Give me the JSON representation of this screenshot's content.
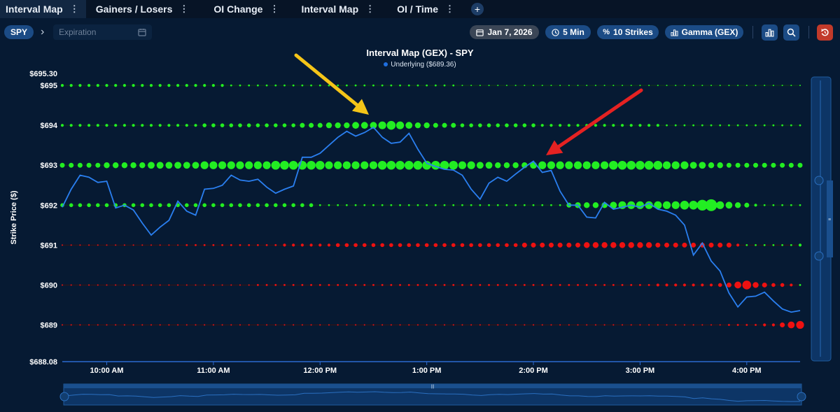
{
  "tabs": [
    {
      "label": "Interval Map",
      "active": true
    },
    {
      "label": "Gainers / Losers",
      "active": false
    },
    {
      "label": "OI Change",
      "active": false
    },
    {
      "label": "Interval Map",
      "active": false
    },
    {
      "label": "OI / Time",
      "active": false
    }
  ],
  "toolbar": {
    "symbol": "SPY",
    "expiration_placeholder": "Expiration",
    "date": "Jan 7, 2026",
    "interval": "5 Min",
    "strikes": "10 Strikes",
    "metric": "Gamma (GEX)"
  },
  "icons": {
    "tab_menu": "vertical-dots-icon",
    "add_tab": "plus-icon",
    "breadcrumb": "chevron-right-icon",
    "expiration": "calendar-icon",
    "date": "calendar-icon",
    "interval": "clock-icon",
    "strikes": "percent-icon",
    "metric": "bar-chart-icon",
    "chart_type": "bar-chart-icon",
    "search": "search-icon",
    "reset": "reset-icon"
  },
  "colors": {
    "background": "#061a33",
    "positive": "#22ee22",
    "negative": "#ee1111",
    "underlying": "#2a7ff0",
    "pill": "#1b4b85",
    "annotation_yellow": "#f5c518",
    "annotation_red": "#e52222"
  },
  "chart_data": {
    "type": "scatter",
    "title": "Interval Map (GEX) - SPY",
    "legend": [
      {
        "name": "Underlying ($689.36)",
        "color": "#2a7ff0"
      }
    ],
    "ylabel": "Strike Price ($)",
    "ylim": [
      688.08,
      695.3
    ],
    "y_top_label": "$695.30",
    "y_bottom_label": "$688.08",
    "strikes": [
      {
        "strike": 695,
        "label": "$695"
      },
      {
        "strike": 694,
        "label": "$694"
      },
      {
        "strike": 693,
        "label": "$693"
      },
      {
        "strike": 692,
        "label": "$692"
      },
      {
        "strike": 691,
        "label": "$691"
      },
      {
        "strike": 690,
        "label": "$690"
      },
      {
        "strike": 689,
        "label": "$689"
      }
    ],
    "x_ticks": [
      "10:00 AM",
      "11:00 AM",
      "12:00 PM",
      "1:00 PM",
      "2:00 PM",
      "3:00 PM",
      "4:00 PM"
    ],
    "x_tick_hours": [
      10,
      11,
      12,
      13,
      14,
      15,
      16
    ],
    "underlying_series": {
      "name": "Underlying",
      "start": "9:35 AM",
      "interval_min": 5,
      "values": [
        691.95,
        692.4,
        692.75,
        692.7,
        692.57,
        692.6,
        691.93,
        692.0,
        691.88,
        691.55,
        691.25,
        691.45,
        691.62,
        692.1,
        691.85,
        691.75,
        692.4,
        692.42,
        692.5,
        692.75,
        692.63,
        692.6,
        692.65,
        692.45,
        692.3,
        692.4,
        692.48,
        693.2,
        693.2,
        693.3,
        693.5,
        693.7,
        693.85,
        693.73,
        693.82,
        693.95,
        693.7,
        693.55,
        693.58,
        693.8,
        693.4,
        693.05,
        692.97,
        692.9,
        692.88,
        692.75,
        692.4,
        692.15,
        692.55,
        692.7,
        692.6,
        692.78,
        692.95,
        693.1,
        692.82,
        692.87,
        692.35,
        692.0,
        692.0,
        691.7,
        691.68,
        692.07,
        691.9,
        691.95,
        692.0,
        691.95,
        692.05,
        691.9,
        691.85,
        691.75,
        691.5,
        690.75,
        691.05,
        690.6,
        690.35,
        689.8,
        689.45,
        689.7,
        689.72,
        689.82,
        689.6,
        689.4,
        689.32,
        689.36
      ]
    },
    "gex_bubbles": [
      {
        "strike": 695,
        "values": [
          3,
          3,
          3,
          3,
          3,
          3,
          3,
          3,
          3,
          3,
          3,
          3,
          3,
          3,
          3,
          3,
          3,
          3,
          3,
          2,
          2,
          2,
          2,
          2,
          2,
          2,
          2,
          2,
          2,
          2,
          2,
          2,
          2,
          2,
          2,
          2,
          2,
          2,
          2,
          2,
          2,
          2,
          2,
          2,
          2,
          1,
          1,
          1,
          1,
          1,
          1,
          1,
          1,
          1,
          1,
          1,
          1,
          1,
          1,
          1,
          1,
          1,
          1,
          1,
          1,
          1,
          1,
          1,
          1,
          1,
          1,
          1,
          1,
          1,
          1,
          1,
          1,
          1,
          1,
          1,
          1,
          1,
          1,
          1
        ]
      },
      {
        "strike": 694,
        "values": [
          3,
          3,
          3,
          3,
          3,
          3,
          3,
          3,
          3,
          3,
          3,
          3,
          3,
          3,
          3,
          3,
          4,
          4,
          4,
          4,
          4,
          4,
          4,
          4,
          4,
          4,
          4,
          5,
          5,
          5,
          6,
          6,
          6,
          7,
          7,
          7,
          8,
          9,
          8,
          7,
          6,
          6,
          5,
          5,
          5,
          4,
          4,
          4,
          4,
          4,
          4,
          4,
          4,
          4,
          3,
          3,
          3,
          3,
          3,
          3,
          3,
          3,
          3,
          3,
          3,
          3,
          3,
          3,
          2,
          2,
          2,
          2,
          2,
          2,
          2,
          2,
          2,
          2,
          2,
          2,
          2,
          2,
          2,
          2
        ]
      },
      {
        "strike": 693,
        "values": [
          5,
          5,
          5,
          5,
          5,
          6,
          6,
          6,
          6,
          6,
          7,
          7,
          7,
          7,
          7,
          7,
          8,
          8,
          8,
          8,
          8,
          8,
          8,
          8,
          9,
          9,
          9,
          9,
          9,
          9,
          8,
          8,
          8,
          8,
          8,
          8,
          9,
          9,
          9,
          9,
          9,
          9,
          9,
          9,
          9,
          8,
          8,
          7,
          7,
          6,
          6,
          6,
          6,
          7,
          8,
          8,
          8,
          8,
          8,
          8,
          8,
          8,
          9,
          9,
          9,
          9,
          9,
          9,
          8,
          8,
          8,
          7,
          7,
          6,
          6,
          5,
          5,
          5,
          5,
          5,
          5,
          5,
          5,
          5
        ]
      },
      {
        "strike": 692,
        "values": [
          4,
          4,
          4,
          4,
          4,
          4,
          4,
          4,
          4,
          4,
          4,
          4,
          4,
          4,
          4,
          4,
          4,
          4,
          4,
          4,
          4,
          4,
          4,
          4,
          4,
          4,
          4,
          4,
          4,
          2,
          2,
          2,
          2,
          2,
          2,
          2,
          2,
          2,
          2,
          2,
          2,
          2,
          2,
          2,
          2,
          2,
          2,
          2,
          2,
          2,
          2,
          2,
          2,
          2,
          2,
          2,
          2,
          5,
          6,
          6,
          6,
          6,
          7,
          8,
          8,
          8,
          8,
          8,
          8,
          8,
          9,
          9,
          11,
          12,
          8,
          7,
          6,
          5,
          3,
          2,
          2,
          2,
          2,
          2
        ]
      },
      {
        "strike": 691,
        "values": [
          -1,
          -1,
          -1,
          -1,
          -1,
          -1,
          -1,
          -1,
          -1,
          -1,
          -1,
          -1,
          -1,
          -1,
          -2,
          -2,
          -2,
          -2,
          -2,
          -2,
          -2,
          -2,
          -2,
          -2,
          -2,
          -3,
          -3,
          -3,
          -3,
          -3,
          -3,
          -4,
          -4,
          -4,
          -4,
          -4,
          -4,
          -4,
          -4,
          -4,
          -4,
          -4,
          -4,
          -4,
          -4,
          -4,
          -4,
          -4,
          -4,
          -4,
          -4,
          -4,
          -5,
          -5,
          -5,
          -5,
          -5,
          -5,
          -5,
          -6,
          -6,
          -6,
          -6,
          -6,
          -6,
          -6,
          -6,
          -5,
          -5,
          -5,
          -5,
          -5,
          -5,
          -5,
          -5,
          -5,
          -3,
          2,
          2,
          2,
          2,
          2,
          2,
          3
        ]
      },
      {
        "strike": 690,
        "values": [
          -1,
          -1,
          -1,
          -1,
          -1,
          -1,
          -1,
          -1,
          -1,
          -1,
          -1,
          -1,
          -1,
          -1,
          -1,
          -1,
          -1,
          -1,
          -1,
          -1,
          -1,
          -1,
          -2,
          -2,
          -2,
          -2,
          -2,
          -2,
          -2,
          -2,
          -2,
          -2,
          -2,
          -2,
          -2,
          -2,
          -2,
          -2,
          -2,
          -2,
          -2,
          -2,
          -2,
          -2,
          -2,
          -2,
          -2,
          -2,
          -2,
          -2,
          -2,
          -2,
          -2,
          -2,
          -2,
          -2,
          -2,
          -2,
          -2,
          -2,
          -2,
          -2,
          -2,
          -2,
          -2,
          -2,
          -2,
          -3,
          -3,
          -3,
          -3,
          -3,
          -3,
          -3,
          -4,
          -5,
          -7,
          -9,
          -6,
          -5,
          -4,
          -4,
          -3,
          2
        ]
      },
      {
        "strike": 689,
        "values": [
          -1,
          -1,
          -1,
          -1,
          -1,
          -1,
          -1,
          -1,
          -1,
          -1,
          -1,
          -1,
          -1,
          -1,
          -1,
          -1,
          -1,
          -1,
          -1,
          -1,
          -1,
          -1,
          -1,
          -1,
          -1,
          -1,
          -1,
          -1,
          -1,
          -1,
          -1,
          -1,
          -1,
          -1,
          -1,
          -1,
          -1,
          -1,
          -1,
          -1,
          -1,
          -1,
          -1,
          -1,
          -1,
          -1,
          -1,
          -1,
          -1,
          -1,
          -1,
          -1,
          -1,
          -1,
          -1,
          -1,
          -1,
          -1,
          -1,
          -1,
          -1,
          -1,
          -1,
          -1,
          -1,
          -1,
          -1,
          -1,
          -1,
          -1,
          -1,
          -1,
          -1,
          -1,
          -1,
          -2,
          -2,
          -2,
          -2,
          -3,
          -3,
          -5,
          -7,
          -8
        ]
      }
    ],
    "grid": false
  },
  "annotations": [
    {
      "name": "yellow-arrow",
      "color": "#f5c518"
    },
    {
      "name": "red-arrow",
      "color": "#e52222"
    }
  ]
}
